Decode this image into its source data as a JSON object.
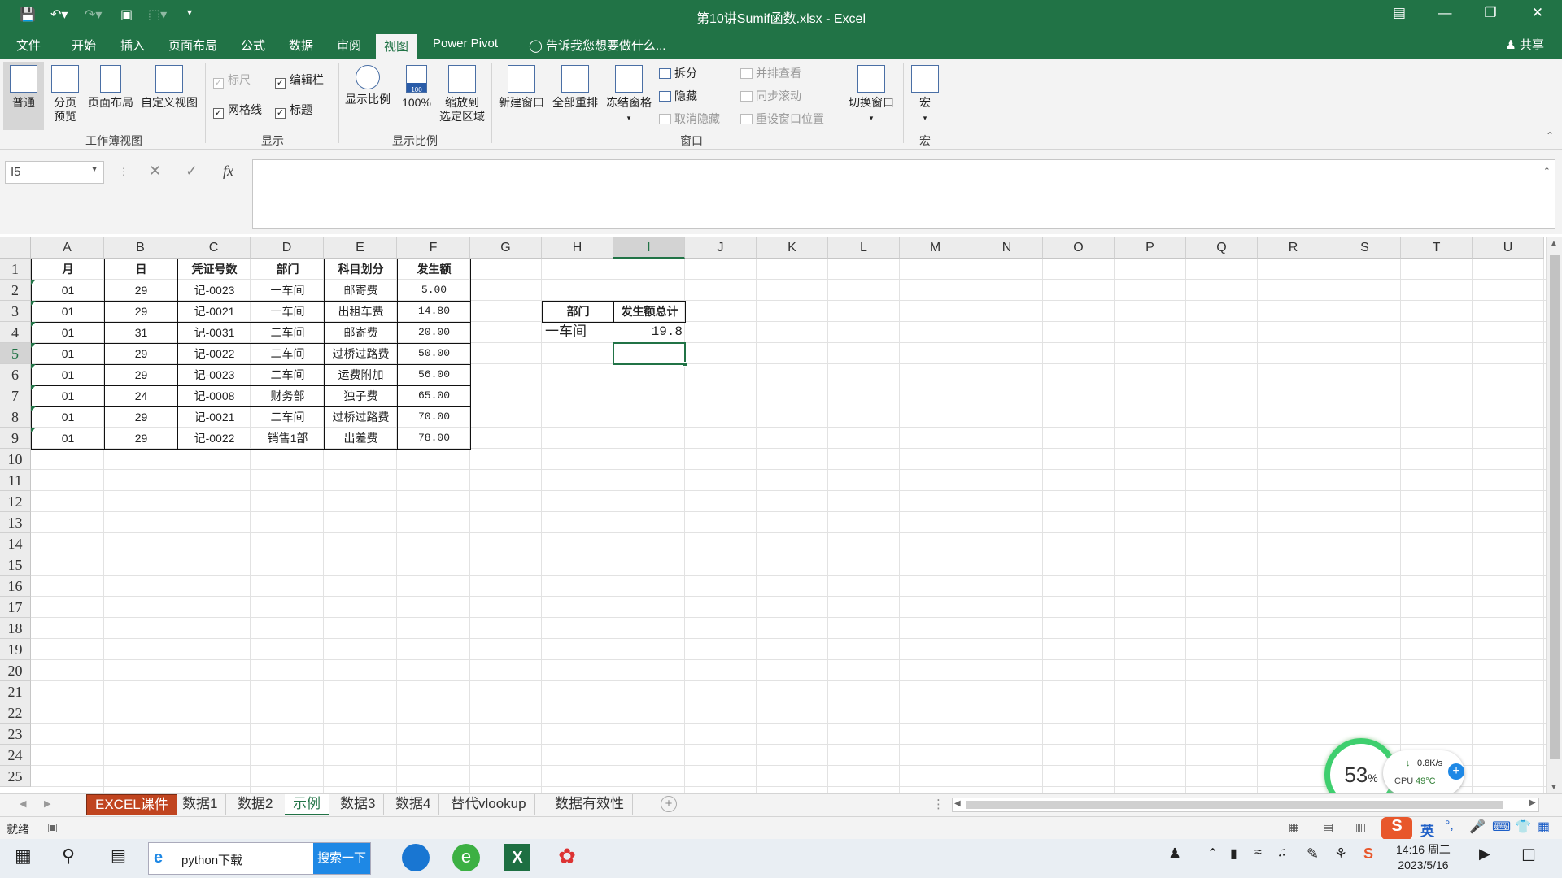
{
  "window": {
    "title": "第10讲Sumif函数.xlsx - Excel",
    "share": "共享"
  },
  "tabs": [
    "文件",
    "开始",
    "插入",
    "页面布局",
    "公式",
    "数据",
    "审阅",
    "视图",
    "Power Pivot"
  ],
  "active_tab": "视图",
  "tell_me": "告诉我您想要做什么...",
  "ribbon": {
    "views": {
      "normal": "普通",
      "page_break_l1": "分页",
      "page_break_l2": "预览",
      "page_layout": "页面布局",
      "custom": "自定义视图",
      "group": "工作簿视图"
    },
    "show": {
      "ruler": "标尺",
      "formula_bar": "编辑栏",
      "gridlines": "网格线",
      "headings": "标题",
      "group": "显示"
    },
    "zoom": {
      "zoom": "显示比例",
      "hundred": "100%",
      "sel_l1": "缩放到",
      "sel_l2": "选定区域",
      "group": "显示比例",
      "badge": "100"
    },
    "window": {
      "new": "新建窗口",
      "arrange": "全部重排",
      "freeze": "冻结窗格",
      "split": "拆分",
      "hide": "隐藏",
      "unhide": "取消隐藏",
      "side": "并排查看",
      "sync": "同步滚动",
      "reset": "重设窗口位置",
      "switch": "切换窗口",
      "group": "窗口"
    },
    "macros": {
      "macro": "宏",
      "group": "宏"
    }
  },
  "namebox": "I5",
  "fx": "fx",
  "columns": [
    "A",
    "B",
    "C",
    "D",
    "E",
    "F",
    "G",
    "H",
    "I",
    "J",
    "K",
    "L",
    "M",
    "N",
    "O",
    "P",
    "Q",
    "R",
    "S",
    "T",
    "U"
  ],
  "rows": [
    "1",
    "2",
    "3",
    "4",
    "5",
    "6",
    "7",
    "8",
    "9",
    "10",
    "11",
    "12",
    "13",
    "14",
    "15",
    "16",
    "17",
    "18",
    "19",
    "20",
    "21",
    "22",
    "23",
    "24",
    "25"
  ],
  "table": {
    "headers": [
      "月",
      "日",
      "凭证号数",
      "部门",
      "科目划分",
      "发生额"
    ],
    "rows": [
      [
        "01",
        "29",
        "记-0023",
        "一车间",
        "邮寄费",
        "5.00"
      ],
      [
        "01",
        "29",
        "记-0021",
        "一车间",
        "出租车费",
        "14.80"
      ],
      [
        "01",
        "31",
        "记-0031",
        "二车间",
        "邮寄费",
        "20.00"
      ],
      [
        "01",
        "29",
        "记-0022",
        "二车间",
        "过桥过路费",
        "50.00"
      ],
      [
        "01",
        "29",
        "记-0023",
        "二车间",
        "运费附加",
        "56.00"
      ],
      [
        "01",
        "24",
        "记-0008",
        "财务部",
        "独子费",
        "65.00"
      ],
      [
        "01",
        "29",
        "记-0021",
        "二车间",
        "过桥过路费",
        "70.00"
      ],
      [
        "01",
        "29",
        "记-0022",
        "销售1部",
        "出差费",
        "78.00"
      ]
    ]
  },
  "summary": {
    "h_header": "部门",
    "i_header": "发生额总计",
    "h_value": "一车间",
    "i_value": "19.8"
  },
  "sheets": [
    "EXCEL课件",
    "数据1",
    "数据2",
    "示例",
    "数据3",
    "数据4",
    "替代vlookup",
    "数据有效性"
  ],
  "active_sheet": "示例",
  "status": {
    "ready": "就绪"
  },
  "cpu": {
    "percent": "53",
    "pct_sign": "%",
    "net": "0.8K/s",
    "temp_label": "CPU",
    "temp": "49°C"
  },
  "taskbar": {
    "search_text": "python下载",
    "search_button": "搜索一下",
    "time": "14:16 周二",
    "date": "2023/5/16",
    "ime": "英"
  },
  "colors": {
    "excel_green": "#217346",
    "first_tab": "#c0441f"
  }
}
